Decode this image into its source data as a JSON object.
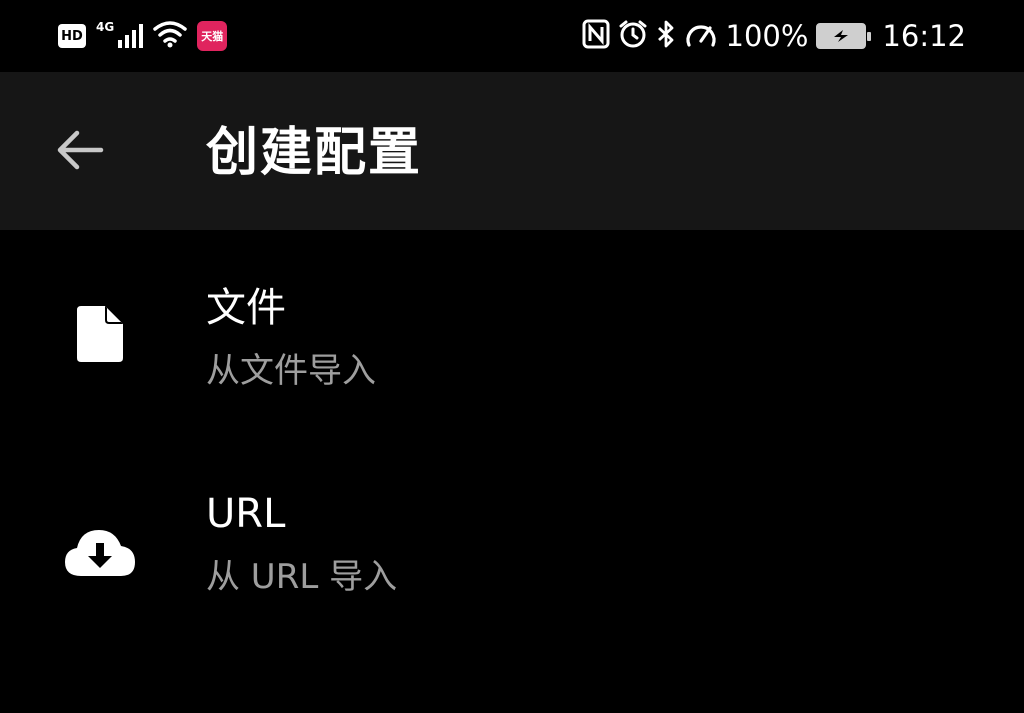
{
  "status_bar": {
    "hd_label": "HD",
    "network_type": "4G",
    "app_notification_label": "天猫",
    "battery_percent": "100%",
    "time": "16:12",
    "icons": [
      "hd-icon",
      "signal-icon",
      "wifi-icon",
      "app-notification-icon",
      "nfc-icon",
      "alarm-icon",
      "bluetooth-icon",
      "speed-icon",
      "battery-icon"
    ]
  },
  "app_bar": {
    "title": "创建配置",
    "back_icon": "arrow-left-icon"
  },
  "list": {
    "items": [
      {
        "title": "文件",
        "subtitle": "从文件导入",
        "icon": "file-icon"
      },
      {
        "title": "URL",
        "subtitle": "从 URL 导入",
        "icon": "cloud-download-icon"
      }
    ]
  },
  "colors": {
    "background": "#000000",
    "app_bar": "#161616",
    "primary_text": "#ffffff",
    "secondary_text": "#9e9e9e",
    "notification_accent": "#e0245e"
  }
}
